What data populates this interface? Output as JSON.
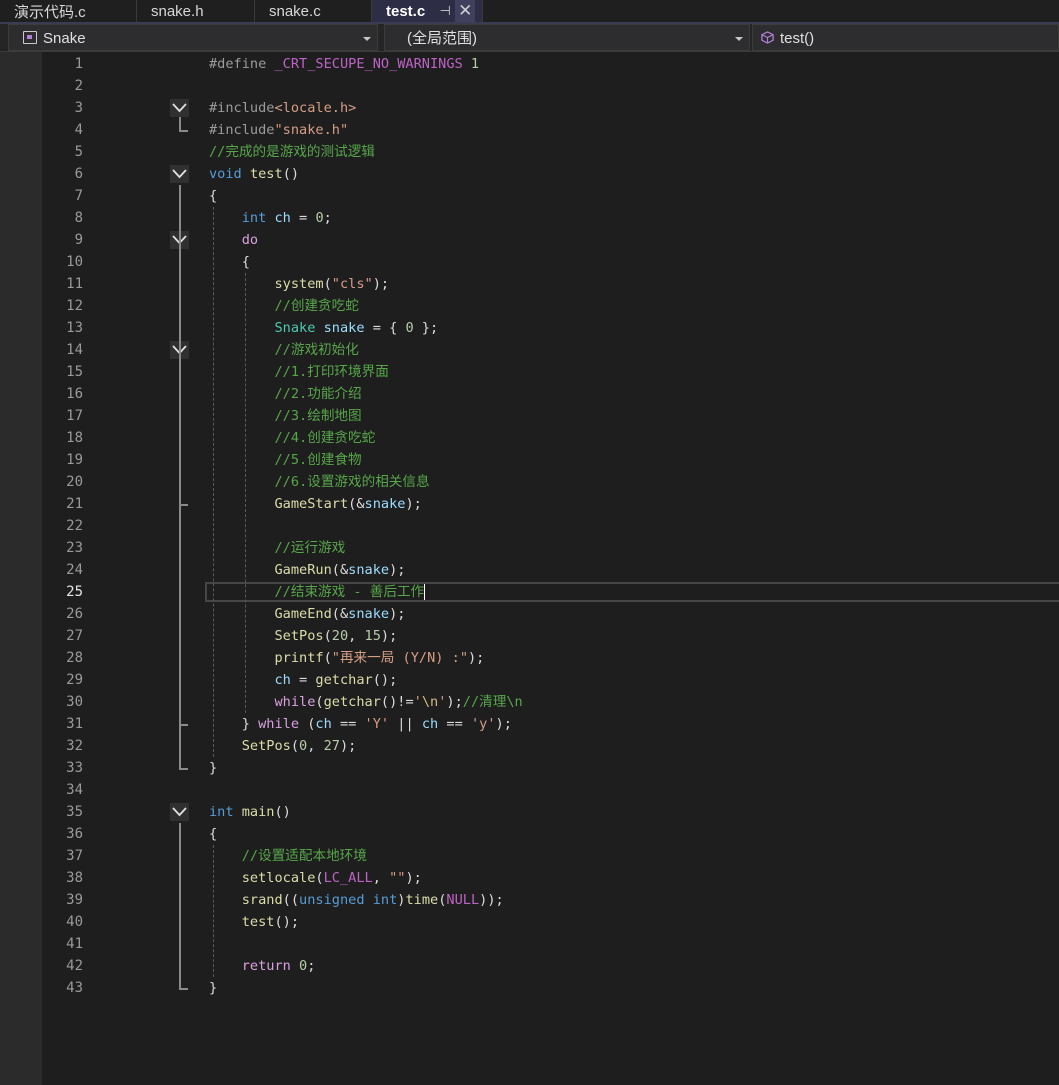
{
  "tabs": [
    {
      "label": "演示代码.c",
      "active": false
    },
    {
      "label": "snake.h",
      "active": false
    },
    {
      "label": "snake.c",
      "active": false
    },
    {
      "label": "test.c",
      "active": true
    }
  ],
  "navbar": {
    "project": "Snake",
    "scope": "(全局范围)",
    "member": "test()"
  },
  "editor": {
    "current_line": 25,
    "lines": [
      {
        "n": "1",
        "code": [
          [
            "pp",
            "#define "
          ],
          [
            "mac",
            "_CRT_SECUPE_NO_WARNINGS"
          ],
          [
            "num",
            " 1"
          ]
        ]
      },
      {
        "n": "2",
        "code": []
      },
      {
        "n": "3",
        "code": [
          [
            "pp",
            "#include"
          ],
          [
            "str",
            "<locale.h>"
          ]
        ]
      },
      {
        "n": "4",
        "code": [
          [
            "pp",
            "#include"
          ],
          [
            "str",
            "\"snake.h\""
          ]
        ]
      },
      {
        "n": "5",
        "code": [
          [
            "cm",
            "//完成的是游戏的测试逻辑"
          ]
        ]
      },
      {
        "n": "6",
        "code": [
          [
            "kw",
            "void"
          ],
          [
            "pl",
            " "
          ],
          [
            "fn",
            "test"
          ],
          [
            "pl",
            "()"
          ]
        ]
      },
      {
        "n": "7",
        "code": [
          [
            "pl",
            "{"
          ]
        ]
      },
      {
        "n": "8",
        "code": [
          [
            "pl",
            "    "
          ],
          [
            "kw",
            "int"
          ],
          [
            "pl",
            " "
          ],
          [
            "var",
            "ch"
          ],
          [
            "pl",
            " = "
          ],
          [
            "num",
            "0"
          ],
          [
            "pl",
            ";"
          ]
        ]
      },
      {
        "n": "9",
        "code": [
          [
            "pl",
            "    "
          ],
          [
            "kw2",
            "do"
          ]
        ]
      },
      {
        "n": "10",
        "code": [
          [
            "pl",
            "    {"
          ]
        ]
      },
      {
        "n": "11",
        "code": [
          [
            "pl",
            "        "
          ],
          [
            "fn",
            "system"
          ],
          [
            "pl",
            "("
          ],
          [
            "str",
            "\"cls\""
          ],
          [
            "pl",
            ");"
          ]
        ]
      },
      {
        "n": "12",
        "code": [
          [
            "pl",
            "        "
          ],
          [
            "cm",
            "//创建贪吃蛇"
          ]
        ]
      },
      {
        "n": "13",
        "code": [
          [
            "pl",
            "        "
          ],
          [
            "ty",
            "Snake"
          ],
          [
            "pl",
            " "
          ],
          [
            "var",
            "snake"
          ],
          [
            "pl",
            " = { "
          ],
          [
            "num",
            "0"
          ],
          [
            "pl",
            " };"
          ]
        ]
      },
      {
        "n": "14",
        "code": [
          [
            "pl",
            "        "
          ],
          [
            "cm",
            "//游戏初始化"
          ]
        ]
      },
      {
        "n": "15",
        "code": [
          [
            "pl",
            "        "
          ],
          [
            "cm",
            "//1.打印环境界面"
          ]
        ]
      },
      {
        "n": "16",
        "code": [
          [
            "pl",
            "        "
          ],
          [
            "cm",
            "//2.功能介绍"
          ]
        ]
      },
      {
        "n": "17",
        "code": [
          [
            "pl",
            "        "
          ],
          [
            "cm",
            "//3.绘制地图"
          ]
        ]
      },
      {
        "n": "18",
        "code": [
          [
            "pl",
            "        "
          ],
          [
            "cm",
            "//4.创建贪吃蛇"
          ]
        ]
      },
      {
        "n": "19",
        "code": [
          [
            "pl",
            "        "
          ],
          [
            "cm",
            "//5.创建食物"
          ]
        ]
      },
      {
        "n": "20",
        "code": [
          [
            "pl",
            "        "
          ],
          [
            "cm",
            "//6.设置游戏的相关信息"
          ]
        ]
      },
      {
        "n": "21",
        "code": [
          [
            "pl",
            "        "
          ],
          [
            "fn",
            "GameStart"
          ],
          [
            "pl",
            "(&"
          ],
          [
            "var",
            "snake"
          ],
          [
            "pl",
            ");"
          ]
        ]
      },
      {
        "n": "22",
        "code": []
      },
      {
        "n": "23",
        "code": [
          [
            "pl",
            "        "
          ],
          [
            "cm",
            "//运行游戏"
          ]
        ]
      },
      {
        "n": "24",
        "code": [
          [
            "pl",
            "        "
          ],
          [
            "fn",
            "GameRun"
          ],
          [
            "pl",
            "(&"
          ],
          [
            "var",
            "snake"
          ],
          [
            "pl",
            ");"
          ]
        ]
      },
      {
        "n": "25",
        "code": [
          [
            "pl",
            "        "
          ],
          [
            "cm",
            "//结束游戏 - 善后工作"
          ]
        ]
      },
      {
        "n": "26",
        "code": [
          [
            "pl",
            "        "
          ],
          [
            "fn",
            "GameEnd"
          ],
          [
            "pl",
            "(&"
          ],
          [
            "var",
            "snake"
          ],
          [
            "pl",
            ");"
          ]
        ]
      },
      {
        "n": "27",
        "code": [
          [
            "pl",
            "        "
          ],
          [
            "fn",
            "SetPos"
          ],
          [
            "pl",
            "("
          ],
          [
            "num",
            "20"
          ],
          [
            "pl",
            ", "
          ],
          [
            "num",
            "15"
          ],
          [
            "pl",
            ");"
          ]
        ]
      },
      {
        "n": "28",
        "code": [
          [
            "pl",
            "        "
          ],
          [
            "fn",
            "printf"
          ],
          [
            "pl",
            "("
          ],
          [
            "str",
            "\"再来一局 (Y/N) :\""
          ],
          [
            "pl",
            ");"
          ]
        ]
      },
      {
        "n": "29",
        "code": [
          [
            "pl",
            "        "
          ],
          [
            "var",
            "ch"
          ],
          [
            "pl",
            " = "
          ],
          [
            "fn",
            "getchar"
          ],
          [
            "pl",
            "();"
          ]
        ]
      },
      {
        "n": "30",
        "code": [
          [
            "pl",
            "        "
          ],
          [
            "kw2",
            "while"
          ],
          [
            "pl",
            "("
          ],
          [
            "fn",
            "getchar"
          ],
          [
            "pl",
            "()!="
          ],
          [
            "str",
            "'"
          ],
          [
            "esc",
            "\\n"
          ],
          [
            "str",
            "'"
          ],
          [
            "pl",
            ");"
          ],
          [
            "cm",
            "//清理\\n"
          ]
        ]
      },
      {
        "n": "31",
        "code": [
          [
            "pl",
            "    } "
          ],
          [
            "kw2",
            "while"
          ],
          [
            "pl",
            " ("
          ],
          [
            "var",
            "ch"
          ],
          [
            "pl",
            " == "
          ],
          [
            "str",
            "'Y'"
          ],
          [
            "pl",
            " || "
          ],
          [
            "var",
            "ch"
          ],
          [
            "pl",
            " == "
          ],
          [
            "str",
            "'y'"
          ],
          [
            "pl",
            ");"
          ]
        ]
      },
      {
        "n": "32",
        "code": [
          [
            "pl",
            "    "
          ],
          [
            "fn",
            "SetPos"
          ],
          [
            "pl",
            "("
          ],
          [
            "num",
            "0"
          ],
          [
            "pl",
            ", "
          ],
          [
            "num",
            "27"
          ],
          [
            "pl",
            ");"
          ]
        ]
      },
      {
        "n": "33",
        "code": [
          [
            "pl",
            "}"
          ]
        ]
      },
      {
        "n": "34",
        "code": []
      },
      {
        "n": "35",
        "code": [
          [
            "kw",
            "int"
          ],
          [
            "pl",
            " "
          ],
          [
            "fn",
            "main"
          ],
          [
            "pl",
            "()"
          ]
        ]
      },
      {
        "n": "36",
        "code": [
          [
            "pl",
            "{"
          ]
        ]
      },
      {
        "n": "37",
        "code": [
          [
            "pl",
            "    "
          ],
          [
            "cm",
            "//设置适配本地环境"
          ]
        ]
      },
      {
        "n": "38",
        "code": [
          [
            "pl",
            "    "
          ],
          [
            "fn",
            "setlocale"
          ],
          [
            "pl",
            "("
          ],
          [
            "mac",
            "LC_ALL"
          ],
          [
            "pl",
            ", "
          ],
          [
            "str",
            "\"\""
          ],
          [
            "pl",
            ");"
          ]
        ]
      },
      {
        "n": "39",
        "code": [
          [
            "pl",
            "    "
          ],
          [
            "fn",
            "srand"
          ],
          [
            "pl",
            "(("
          ],
          [
            "kw",
            "unsigned int"
          ],
          [
            "pl",
            ")"
          ],
          [
            "fn",
            "time"
          ],
          [
            "pl",
            "("
          ],
          [
            "mac",
            "NULL"
          ],
          [
            "pl",
            "));"
          ]
        ]
      },
      {
        "n": "40",
        "code": [
          [
            "pl",
            "    "
          ],
          [
            "fn",
            "test"
          ],
          [
            "pl",
            "();"
          ]
        ]
      },
      {
        "n": "41",
        "code": []
      },
      {
        "n": "42",
        "code": [
          [
            "pl",
            "    "
          ],
          [
            "kw2",
            "return"
          ],
          [
            "pl",
            " "
          ],
          [
            "num",
            "0"
          ],
          [
            "pl",
            ";"
          ]
        ]
      },
      {
        "n": "43",
        "code": [
          [
            "pl",
            "}"
          ]
        ]
      }
    ]
  }
}
